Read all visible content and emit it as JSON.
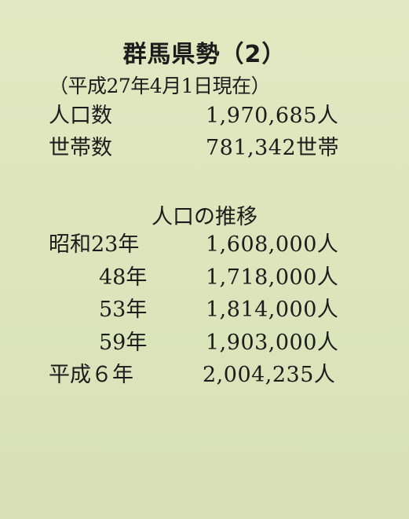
{
  "title": "群馬県勢（2）",
  "subtitle": "（平成27年4月1日現在）",
  "stats": [
    {
      "label": "人口数",
      "value": "1,970,685人"
    },
    {
      "label": "世帯数",
      "value": "781,342世帯"
    }
  ],
  "trend_heading": "人口の推移",
  "trend": [
    {
      "label": "昭和23年",
      "value": "1,608,000人"
    },
    {
      "label": "48年",
      "value": "1,718,000人"
    },
    {
      "label": "53年",
      "value": "1,814,000人"
    },
    {
      "label": "59年",
      "value": "1,903,000人"
    },
    {
      "label": "平成６年",
      "value": "2,004,235人"
    }
  ]
}
